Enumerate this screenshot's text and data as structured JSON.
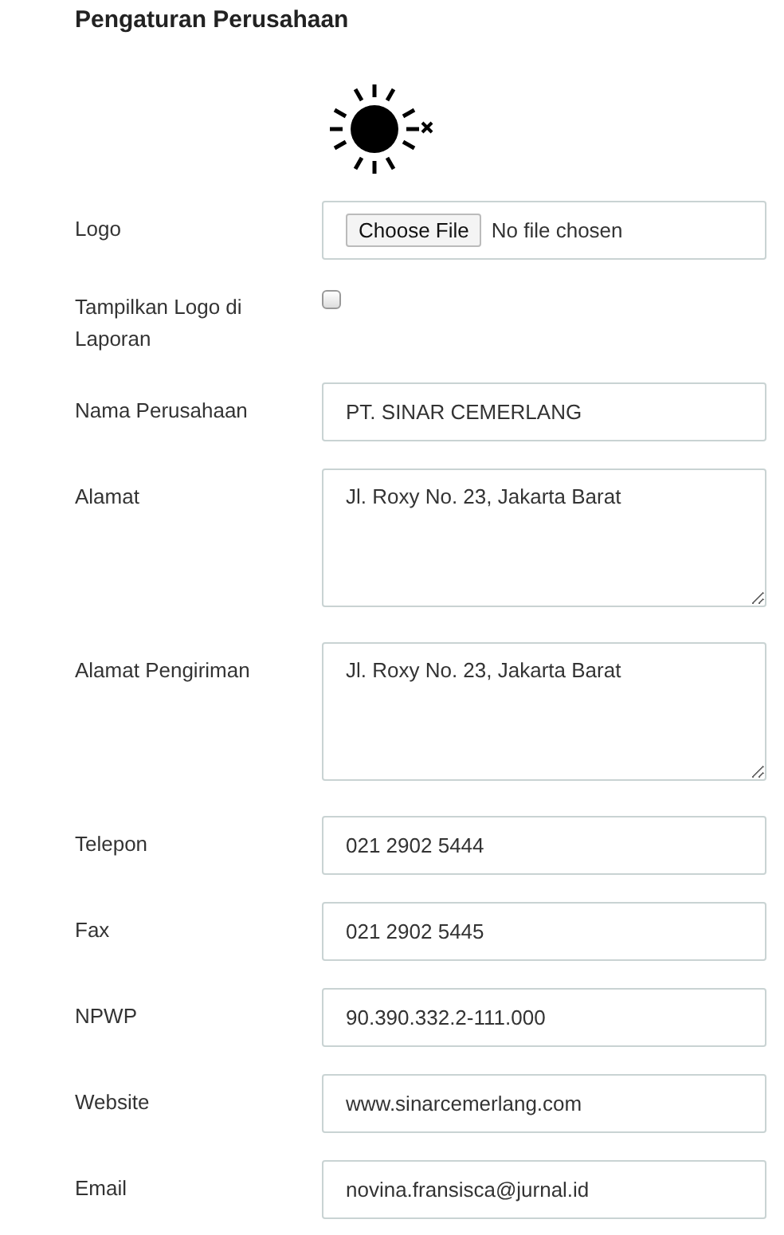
{
  "title": "Pengaturan Perusahaan",
  "fields": [
    {
      "kind": "file",
      "label": "Logo",
      "button": "Choose File",
      "status": "No file chosen"
    },
    {
      "kind": "checkbox",
      "label": "Tampilkan Logo di Laporan",
      "checked": false
    },
    {
      "kind": "text",
      "label": "Nama Perusahaan",
      "value": "PT. SINAR CEMERLANG"
    },
    {
      "kind": "textarea",
      "label": "Alamat",
      "value": "Jl. Roxy No. 23, Jakarta Barat"
    },
    {
      "kind": "textarea",
      "label": "Alamat Pengiriman",
      "value": "Jl. Roxy No. 23, Jakarta Barat"
    },
    {
      "kind": "text",
      "label": "Telepon",
      "value": "021 2902 5444"
    },
    {
      "kind": "text",
      "label": "Fax",
      "value": "021 2902 5445"
    },
    {
      "kind": "text",
      "label": "NPWP",
      "value": "90.390.332.2-111.000"
    },
    {
      "kind": "text",
      "label": "Website",
      "value": "www.sinarcemerlang.com"
    },
    {
      "kind": "text",
      "label": "Email",
      "value": "novina.fransisca@jurnal.id"
    }
  ]
}
